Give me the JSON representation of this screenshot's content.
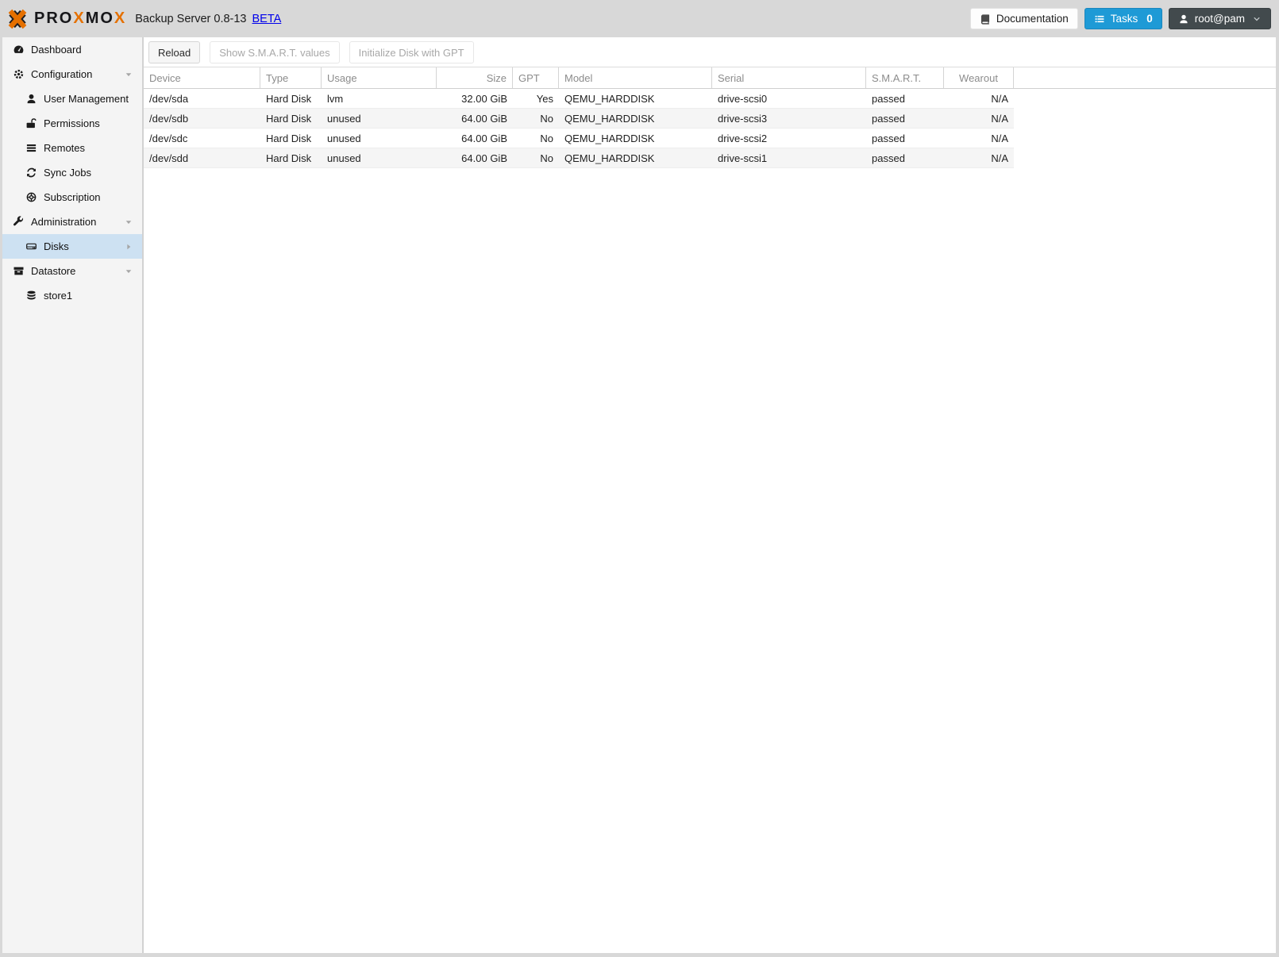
{
  "topbar": {
    "logo_word": {
      "p1": "PRO",
      "x1": "X",
      "p2": "MO",
      "x2": "X"
    },
    "title": "Backup Server 0.8-13",
    "beta_link": "BETA",
    "documentation_button": "Documentation",
    "tasks_button": "Tasks",
    "tasks_count": "0",
    "user_menu": "root@pam"
  },
  "sidebar": {
    "items": [
      {
        "label": "Dashboard",
        "icon": "dashboard",
        "level": 0
      },
      {
        "label": "Configuration",
        "icon": "cogs",
        "level": 0,
        "arrow": "collapse-down"
      },
      {
        "label": "User Management",
        "icon": "user",
        "level": 1
      },
      {
        "label": "Permissions",
        "icon": "unlock",
        "level": 1
      },
      {
        "label": "Remotes",
        "icon": "server-list",
        "level": 1
      },
      {
        "label": "Sync Jobs",
        "icon": "refresh",
        "level": 1
      },
      {
        "label": "Subscription",
        "icon": "support",
        "level": 1
      },
      {
        "label": "Administration",
        "icon": "wrench",
        "level": 0,
        "arrow": "collapse-down"
      },
      {
        "label": "Disks",
        "icon": "hdd",
        "level": 1,
        "selected": true,
        "arrow": "submenu-right"
      },
      {
        "label": "Datastore",
        "icon": "archive",
        "level": 0,
        "arrow": "collapse-down"
      },
      {
        "label": "store1",
        "icon": "database",
        "level": 1
      }
    ]
  },
  "toolbar": {
    "buttons": [
      {
        "label": "Reload",
        "disabled": false
      },
      {
        "label": "Show S.M.A.R.T. values",
        "disabled": true
      },
      {
        "label": "Initialize Disk with GPT",
        "disabled": true
      }
    ]
  },
  "disks_table": {
    "columns": [
      {
        "label": "Device",
        "align": "left"
      },
      {
        "label": "Type",
        "align": "left"
      },
      {
        "label": "Usage",
        "align": "left"
      },
      {
        "label": "Size",
        "align": "right"
      },
      {
        "label": "GPT",
        "align": "right",
        "header_align": "left"
      },
      {
        "label": "Model",
        "align": "left"
      },
      {
        "label": "Serial",
        "align": "left"
      },
      {
        "label": "S.M.A.R.T.",
        "align": "left"
      },
      {
        "label": "Wearout",
        "align": "right",
        "header_align": "center"
      }
    ],
    "rows": [
      [
        "/dev/sda",
        "Hard Disk",
        "lvm",
        "32.00 GiB",
        "Yes",
        "QEMU_HARDDISK",
        "drive-scsi0",
        "passed",
        "N/A"
      ],
      [
        "/dev/sdb",
        "Hard Disk",
        "unused",
        "64.00 GiB",
        "No",
        "QEMU_HARDDISK",
        "drive-scsi3",
        "passed",
        "N/A"
      ],
      [
        "/dev/sdc",
        "Hard Disk",
        "unused",
        "64.00 GiB",
        "No",
        "QEMU_HARDDISK",
        "drive-scsi2",
        "passed",
        "N/A"
      ],
      [
        "/dev/sdd",
        "Hard Disk",
        "unused",
        "64.00 GiB",
        "No",
        "QEMU_HARDDISK",
        "drive-scsi1",
        "passed",
        "N/A"
      ]
    ]
  },
  "colors": {
    "proxmox_orange": "#E57000",
    "tasks_button_blue": "#1E9AD6",
    "beta_link_blue": "#0000EB",
    "sidebar_selected_blue": "#CDE1F2",
    "user_button_dark": "#424A4D"
  }
}
